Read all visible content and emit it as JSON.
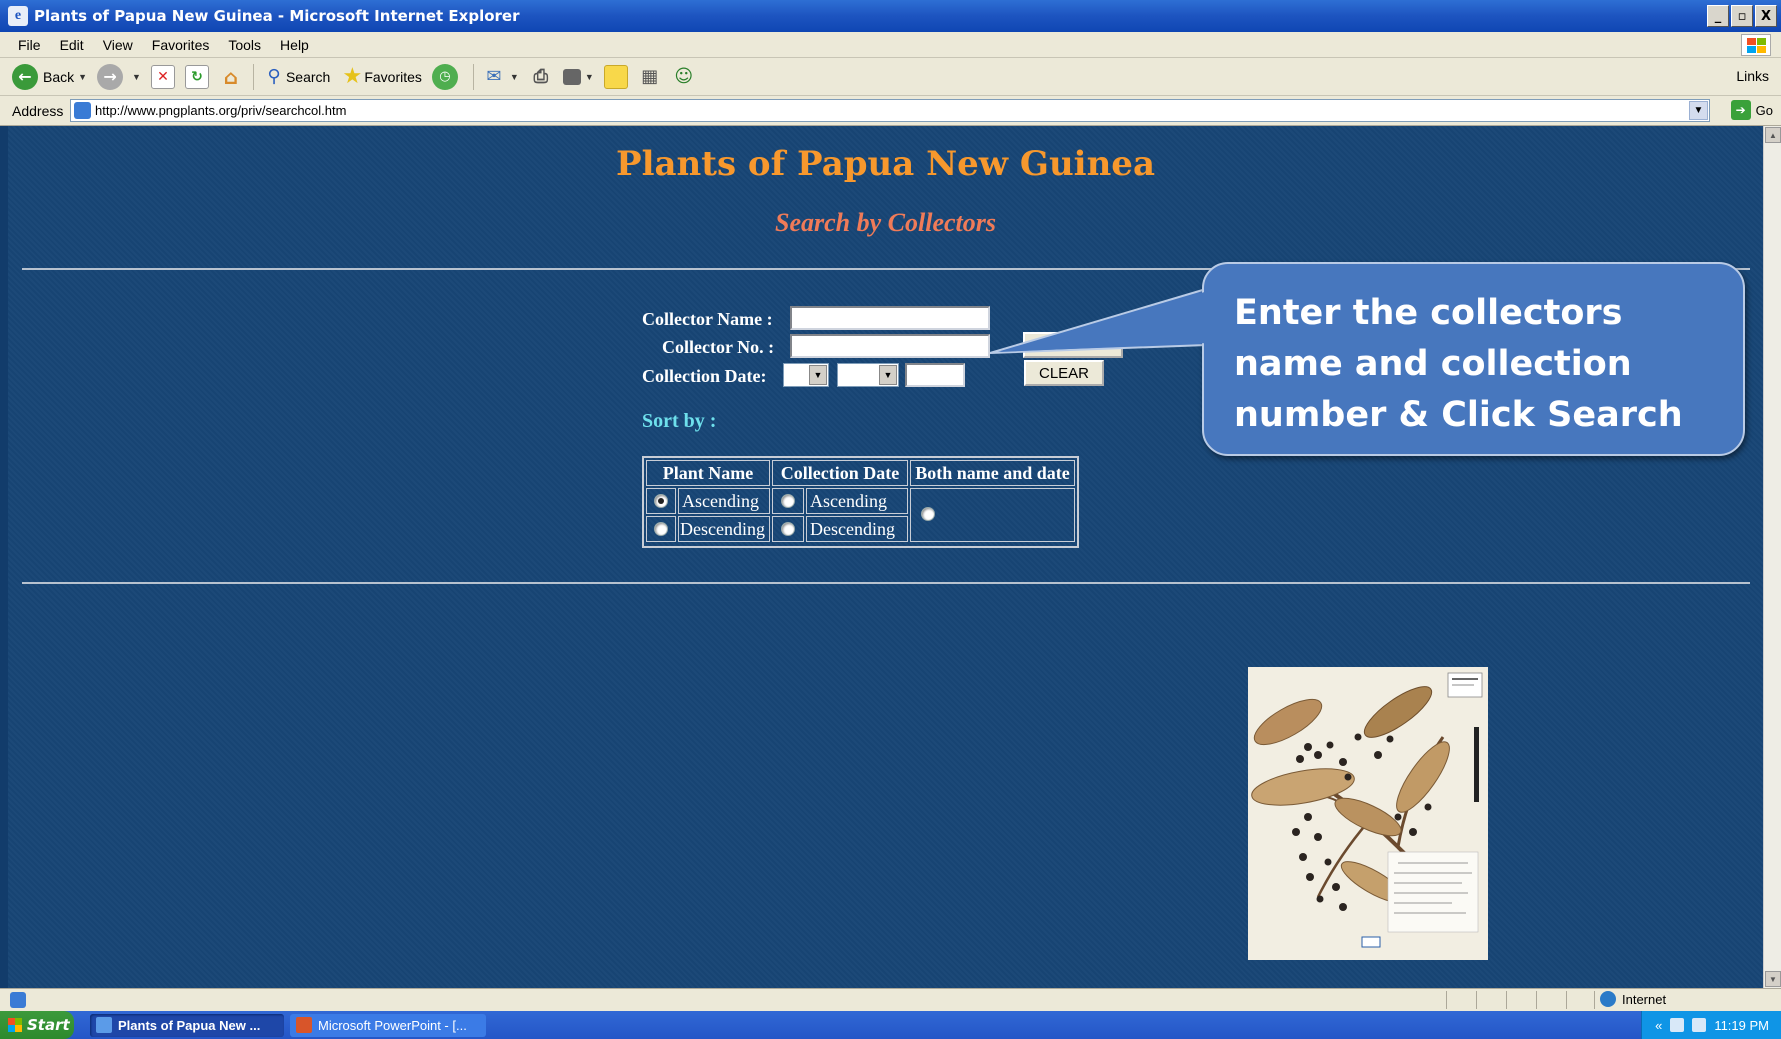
{
  "window": {
    "title": "Plants of Papua New Guinea - Microsoft Internet Explorer",
    "controls": [
      "_",
      "▫",
      "X"
    ]
  },
  "menu": [
    "File",
    "Edit",
    "View",
    "Favorites",
    "Tools",
    "Help"
  ],
  "toolbar": {
    "back_label": "Back",
    "search_label": "Search",
    "favorites_label": "Favorites",
    "links_label": "Links"
  },
  "address": {
    "label": "Address",
    "url": "http://www.pngplants.org/priv/searchcol.htm",
    "go_label": "Go"
  },
  "page": {
    "title": "Plants of Papua New Guinea",
    "subtitle": "Search by Collectors",
    "form": {
      "collector_name_label": "Collector Name :",
      "collector_no_label": "Collector No. :",
      "collection_date_label": "Collection Date:",
      "clear_label": "CLEAR"
    },
    "sort": {
      "label": "Sort by :",
      "headers": [
        "Plant Name",
        "Collection Date",
        "Both name and date"
      ],
      "ascending": "Ascending",
      "descending": "Descending"
    }
  },
  "callout": {
    "text": "Enter the collectors name and collection number & Click Search"
  },
  "statusbar": {
    "zone": "Internet"
  },
  "taskbar": {
    "start_label": "Start",
    "tasks": [
      "Plants of Papua New ...",
      "Microsoft PowerPoint - [..."
    ],
    "tray_chevron": "«",
    "clock": "11:19 PM"
  },
  "colors": {
    "page_background": "#174575",
    "title_orange": "#f7982d",
    "subtitle_salmon": "#f07b58",
    "sort_cyan": "#6ee0ec",
    "callout_blue": "#4777be"
  }
}
